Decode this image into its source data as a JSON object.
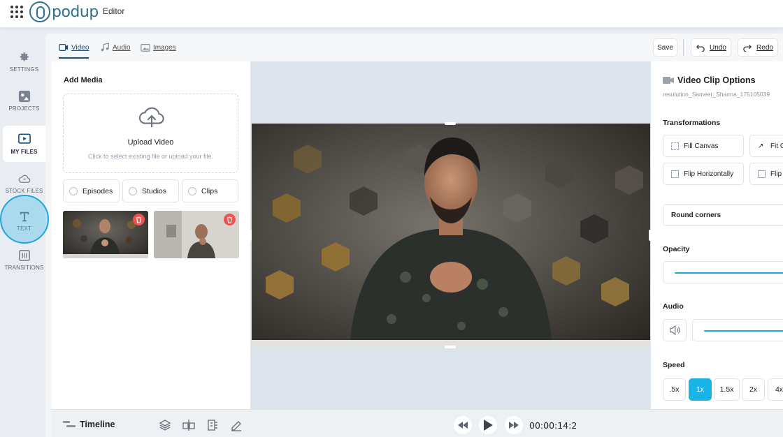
{
  "header": {
    "logo_text": "podup",
    "breadcrumb": "Editor"
  },
  "sidebar": {
    "items": [
      {
        "label": "SETTINGS",
        "icon": "gear-icon"
      },
      {
        "label": "PROJECTS",
        "icon": "projects-icon"
      },
      {
        "label": "MY FILES",
        "icon": "my-files-icon",
        "active": true
      },
      {
        "label": "STOCK FILES",
        "icon": "cloud-icon"
      },
      {
        "label": "TEXT",
        "icon": "text-icon",
        "highlighted": true
      },
      {
        "label": "TRANSITIONS",
        "icon": "transitions-icon"
      }
    ]
  },
  "tabs": [
    {
      "label": "Video",
      "icon": "video-icon",
      "active": true
    },
    {
      "label": "Audio",
      "icon": "music-note-icon"
    },
    {
      "label": "Images",
      "icon": "image-icon"
    }
  ],
  "toolbar": {
    "save_label": "Save",
    "undo_label": "Undo",
    "redo_label": "Redo"
  },
  "media_panel": {
    "title": "Add Media",
    "upload_title": "Upload Video",
    "upload_subtitle": "Click to select existing file or upload your file.",
    "filters": [
      "Episodes",
      "Studios",
      "Clips"
    ],
    "thumbnails": [
      {
        "name": "clip-thumbnail-1",
        "delete_icon": "trash-icon"
      },
      {
        "name": "clip-thumbnail-2",
        "delete_icon": "trash-icon"
      }
    ]
  },
  "options_panel": {
    "title": "Video Clip Options",
    "file_name": "resulution_Sameer_Sharma_175105039",
    "transformations_label": "Transformations",
    "transform_buttons": [
      "Fill Canvas",
      "Fit C",
      "Flip Horizontally",
      "Flip"
    ],
    "round_corners_label": "Round corners",
    "opacity_label": "Opacity",
    "audio_label": "Audio",
    "speed_label": "Speed",
    "speeds": [
      ".5x",
      "1x",
      "1.5x",
      "2x",
      "4x"
    ],
    "active_speed": "1x"
  },
  "timeline": {
    "title": "Timeline",
    "tools": [
      "layers-icon",
      "split-icon",
      "trim-icon",
      "edit-icon"
    ],
    "timecode": "00:00:14:2"
  },
  "colors": {
    "accent": "#18b4e8",
    "brand": "#2f6f8f",
    "delete": "#ef5350"
  }
}
